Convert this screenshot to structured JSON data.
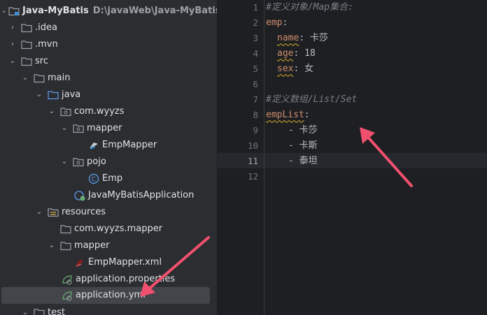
{
  "project_tree": {
    "root": {
      "name": "Java-MyBatis",
      "path": "D:\\javaWeb\\Java-MyBatis"
    },
    "items": [
      {
        "label": ".idea"
      },
      {
        "label": ".mvn"
      },
      {
        "label": "src"
      },
      {
        "label": "main"
      },
      {
        "label": "java"
      },
      {
        "label": "com.wyyzs"
      },
      {
        "label": "mapper"
      },
      {
        "label": "EmpMapper"
      },
      {
        "label": "pojo"
      },
      {
        "label": "Emp"
      },
      {
        "label": "JavaMyBatisApplication"
      },
      {
        "label": "resources"
      },
      {
        "label": "com.wyyzs.mapper"
      },
      {
        "label": "mapper"
      },
      {
        "label": "EmpMapper.xml"
      },
      {
        "label": "application.properties"
      },
      {
        "label": "application.yml"
      },
      {
        "label": "test"
      }
    ]
  },
  "editor": {
    "line_numbers": [
      "1",
      "2",
      "3",
      "4",
      "5",
      "6",
      "7",
      "8",
      "9",
      "10",
      "11",
      "12"
    ],
    "current_line": "11",
    "lines": {
      "l1_comment": "#定义对象/Map集合:",
      "l2_key": "emp",
      "l3_key": "name",
      "l3_value": "卡莎",
      "l4_key": "age",
      "l4_value": "18",
      "l5_key": "sex",
      "l5_value": "女",
      "l7_comment": "#定义数组/List/Set",
      "l8_key": "empList",
      "l9_value": "卡莎",
      "l10_value": "卡斯",
      "l11_value": "泰坦"
    },
    "colon": ":",
    "dash": "-"
  },
  "colors": {
    "annotation_arrow": "#f0506e",
    "selection": "#43454a",
    "yaml_key": "#cf8e6d",
    "comment": "#7a7e85"
  }
}
